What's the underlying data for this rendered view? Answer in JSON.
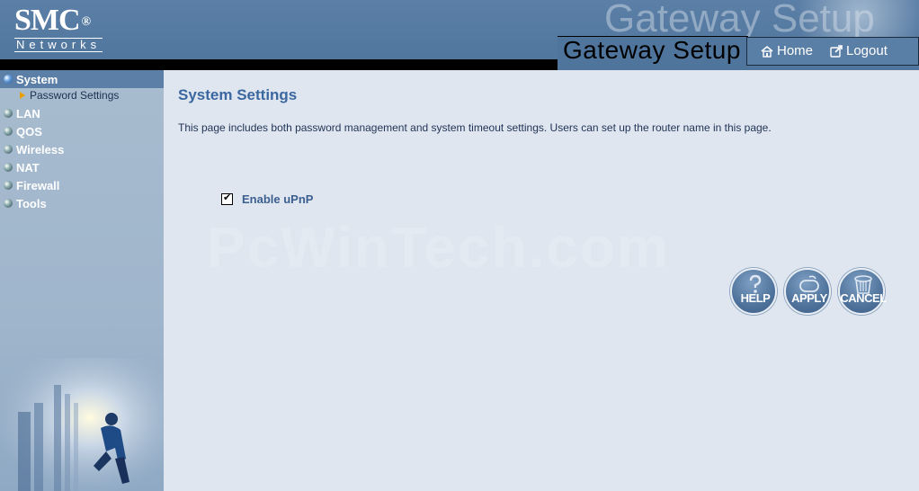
{
  "brand": {
    "name": "SMC",
    "reg": "®",
    "sub": "Networks"
  },
  "header": {
    "ghost_title": "Gateway Setup",
    "title": "Gateway Setup",
    "nav": {
      "home": "Home",
      "logout": "Logout"
    }
  },
  "sidebar": {
    "items": [
      {
        "label": "System",
        "active": true
      },
      {
        "label": "LAN"
      },
      {
        "label": "QOS"
      },
      {
        "label": "Wireless"
      },
      {
        "label": "NAT"
      },
      {
        "label": "Firewall"
      },
      {
        "label": "Tools"
      }
    ],
    "sub_item": "Password Settings"
  },
  "main": {
    "title": "System Settings",
    "description": "This page includes both password management and system timeout settings. Users can set up the router name in this page.",
    "checkbox": {
      "label": "Enable uPnP",
      "checked": true
    },
    "watermark": "PcWinTech.com",
    "buttons": {
      "help": "HELP",
      "apply": "APPLY",
      "cancel": "CANCEL"
    }
  },
  "colors": {
    "header": "#5b7fa6",
    "sidebar": "#a8bccf",
    "main": "#dfe6ef",
    "title": "#3b67a0"
  }
}
